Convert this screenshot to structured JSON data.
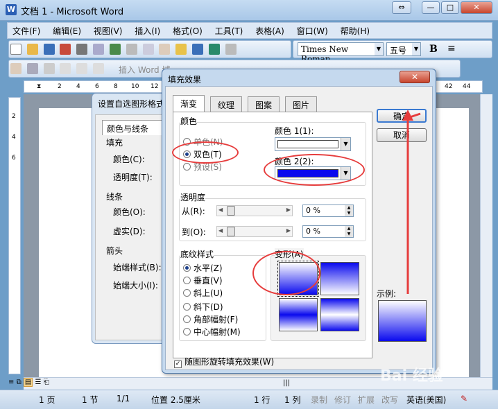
{
  "window": {
    "title": "文档 1 - Microsoft Word",
    "restore_glyph": "⇔",
    "min_glyph": "—",
    "max_glyph": "□",
    "close_glyph": "✕"
  },
  "menu": [
    "文件(F)",
    "编辑(E)",
    "视图(V)",
    "插入(I)",
    "格式(O)",
    "工具(T)",
    "表格(A)",
    "窗口(W)",
    "帮助(H)"
  ],
  "toolbar": {
    "font": "Times New Roman",
    "size": "五号",
    "bold": "B",
    "insert_word": "插入 Word 域"
  },
  "ruler": [
    "2",
    "4",
    "6",
    "8",
    "10",
    "12",
    "42",
    "44"
  ],
  "left_ruler": [
    "2",
    "4",
    "6"
  ],
  "back_dialog": {
    "title": "设置自选图形格式",
    "tab": "颜色与线条",
    "labels": [
      "填充",
      "颜色(C):",
      "透明度(T):",
      "线条",
      "颜色(O):",
      "虚实(D):",
      "箭头",
      "始端样式(B):",
      "始端大小(I):"
    ]
  },
  "dialog": {
    "title": "填充效果",
    "close": "✕",
    "tabs": [
      "渐变",
      "纹理",
      "图案",
      "图片"
    ],
    "color_group": "颜色",
    "color_options": [
      "单色(N)",
      "双色(T)",
      "预设(S)"
    ],
    "color1_label": "颜色 1(1):",
    "color2_label": "颜色 2(2):",
    "color1": "#ffffff",
    "color2": "#0a0aee",
    "transparency_group": "透明度",
    "from_label": "从(R):",
    "to_label": "到(O):",
    "from_value": "0 %",
    "to_value": "0 %",
    "style_group": "底纹样式",
    "styles": [
      "水平(Z)",
      "垂直(V)",
      "斜上(U)",
      "斜下(D)",
      "角部幅射(F)",
      "中心幅射(M)"
    ],
    "variants_label": "变形(A)",
    "ok": "确定",
    "cancel": "取消",
    "sample_label": "示例:",
    "rotate_checkbox": "随图形旋转填充效果(W)"
  },
  "status": {
    "page": "1 页",
    "section": "1 节",
    "pages": "1/1",
    "position": "位置 2.5厘米",
    "line": "1 行",
    "col": "1 列",
    "rec": "录制",
    "trk": "修订",
    "ext": "扩展",
    "ovr": "改写",
    "lang": "英语(美国)"
  },
  "watermark": "Bai 经验"
}
